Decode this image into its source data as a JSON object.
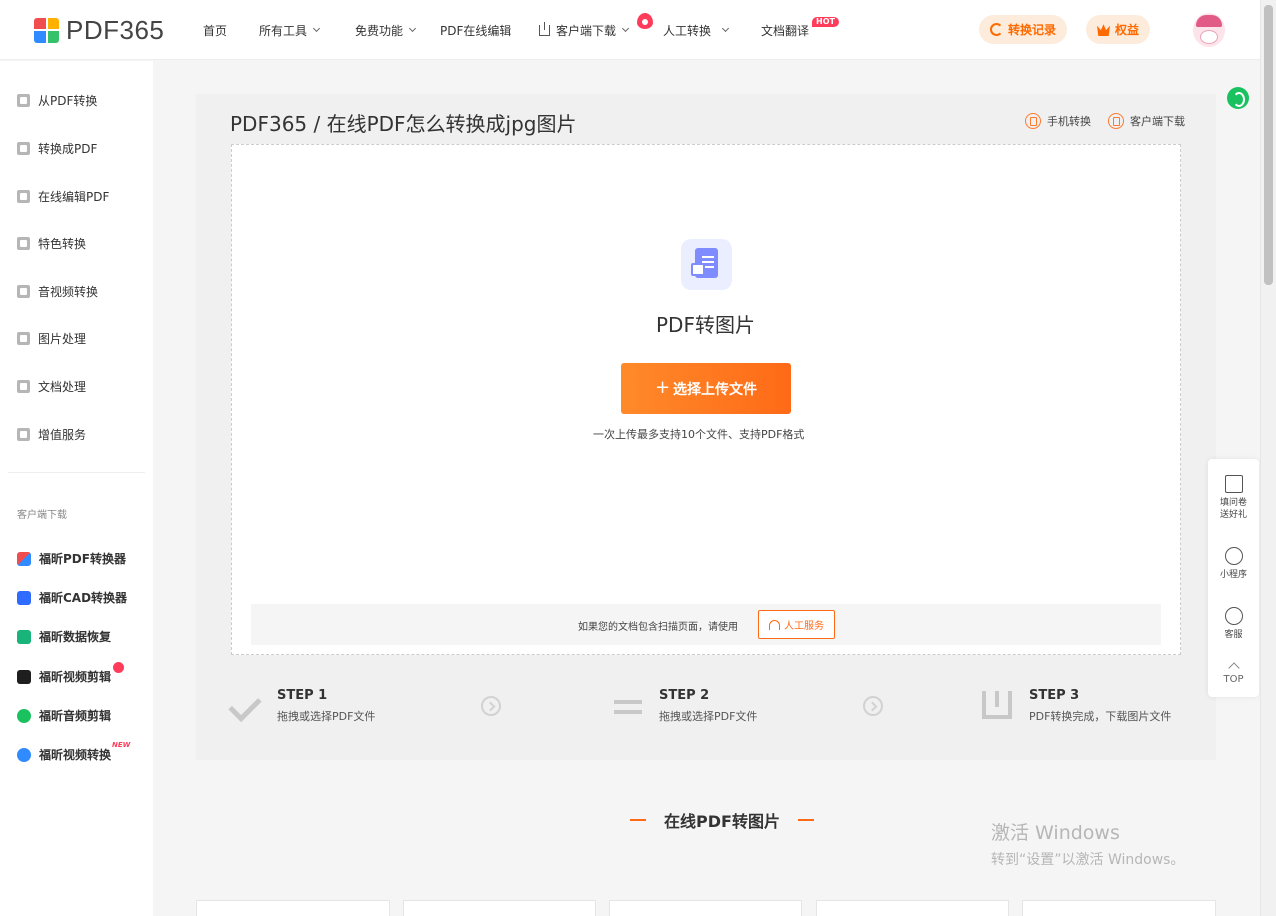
{
  "header": {
    "logo_text": "PDF365",
    "nav": [
      {
        "label": "首页"
      },
      {
        "label": "所有工具"
      },
      {
        "label": "免费功能"
      },
      {
        "label": "PDF在线编辑"
      },
      {
        "label": "客户端下载"
      },
      {
        "label": "人工转换"
      },
      {
        "label": "文档翻译"
      }
    ],
    "hot_badge": "HOT",
    "history_label": "转换记录",
    "benefits_label": "权益"
  },
  "sidebar": {
    "items": [
      {
        "label": "从PDF转换",
        "icon": "from-pdf-icon"
      },
      {
        "label": "转换成PDF",
        "icon": "to-pdf-icon"
      },
      {
        "label": "在线编辑PDF",
        "icon": "edit-pdf-icon"
      },
      {
        "label": "特色转换",
        "icon": "special-convert-icon"
      },
      {
        "label": "音视频转换",
        "icon": "av-convert-icon"
      },
      {
        "label": "图片处理",
        "icon": "image-process-icon"
      },
      {
        "label": "文档处理",
        "icon": "doc-process-icon"
      },
      {
        "label": "增值服务",
        "icon": "value-service-icon"
      }
    ],
    "client_title": "客户端下载",
    "apps": [
      {
        "label": "福昕PDF转换器",
        "color": "#2f8bff"
      },
      {
        "label": "福昕CAD转换器",
        "color": "#2f6bff"
      },
      {
        "label": "福昕数据恢复",
        "color": "#18b47a"
      },
      {
        "label": "福昕视频剪辑",
        "color": "#1e1e1e"
      },
      {
        "label": "福昕音频剪辑",
        "color": "#19c15f"
      },
      {
        "label": "福昕视频转换",
        "color": "#2f8bff"
      }
    ],
    "new_badge": "NEW"
  },
  "main": {
    "page_title": "PDF365 / 在线PDF怎么转换成jpg图片",
    "mobile_label": "手机转换",
    "client_label": "客户端下载",
    "tool_name": "PDF转图片",
    "upload_button": "选择上传文件",
    "upload_hint": "一次上传最多支持10个文件、支持PDF格式",
    "scan_hint": "如果您的文档包含扫描页面，请使用",
    "manual_service": "人工服务",
    "steps": [
      {
        "title": "STEP 1",
        "desc": "拖拽或选择PDF文件"
      },
      {
        "title": "STEP 2",
        "desc": "拖拽或选择PDF文件"
      },
      {
        "title": "STEP 3",
        "desc": "PDF转换完成，下载图片文件"
      }
    ],
    "section_title": "在线PDF转图片"
  },
  "float_bar": {
    "survey_line1": "填问卷",
    "survey_line2": "送好礼",
    "miniapp": "小程序",
    "service": "客服",
    "top": "TOP"
  },
  "watermark": {
    "line1": "激活 Windows",
    "line2": "转到“设置”以激活 Windows。"
  },
  "colors": {
    "accent": "#ff6a17",
    "hot": "#ff3d5a"
  }
}
